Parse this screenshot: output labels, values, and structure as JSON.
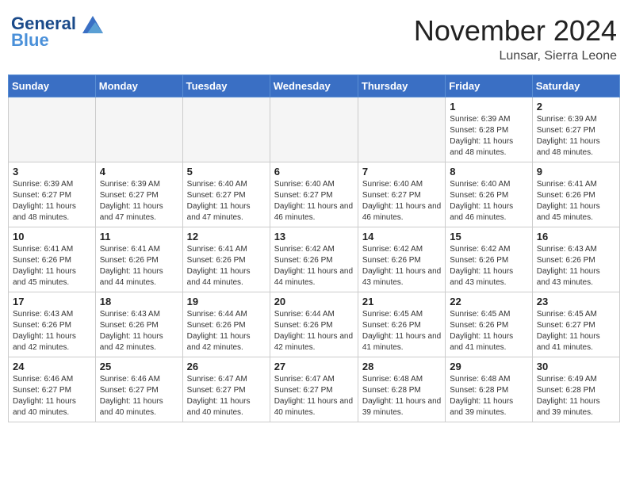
{
  "header": {
    "logo_line1": "General",
    "logo_line2": "Blue",
    "month_title": "November 2024",
    "location": "Lunsar, Sierra Leone"
  },
  "weekdays": [
    "Sunday",
    "Monday",
    "Tuesday",
    "Wednesday",
    "Thursday",
    "Friday",
    "Saturday"
  ],
  "weeks": [
    [
      {
        "day": "",
        "info": ""
      },
      {
        "day": "",
        "info": ""
      },
      {
        "day": "",
        "info": ""
      },
      {
        "day": "",
        "info": ""
      },
      {
        "day": "",
        "info": ""
      },
      {
        "day": "1",
        "info": "Sunrise: 6:39 AM\nSunset: 6:28 PM\nDaylight: 11 hours and 48 minutes."
      },
      {
        "day": "2",
        "info": "Sunrise: 6:39 AM\nSunset: 6:27 PM\nDaylight: 11 hours and 48 minutes."
      }
    ],
    [
      {
        "day": "3",
        "info": "Sunrise: 6:39 AM\nSunset: 6:27 PM\nDaylight: 11 hours and 48 minutes."
      },
      {
        "day": "4",
        "info": "Sunrise: 6:39 AM\nSunset: 6:27 PM\nDaylight: 11 hours and 47 minutes."
      },
      {
        "day": "5",
        "info": "Sunrise: 6:40 AM\nSunset: 6:27 PM\nDaylight: 11 hours and 47 minutes."
      },
      {
        "day": "6",
        "info": "Sunrise: 6:40 AM\nSunset: 6:27 PM\nDaylight: 11 hours and 46 minutes."
      },
      {
        "day": "7",
        "info": "Sunrise: 6:40 AM\nSunset: 6:27 PM\nDaylight: 11 hours and 46 minutes."
      },
      {
        "day": "8",
        "info": "Sunrise: 6:40 AM\nSunset: 6:26 PM\nDaylight: 11 hours and 46 minutes."
      },
      {
        "day": "9",
        "info": "Sunrise: 6:41 AM\nSunset: 6:26 PM\nDaylight: 11 hours and 45 minutes."
      }
    ],
    [
      {
        "day": "10",
        "info": "Sunrise: 6:41 AM\nSunset: 6:26 PM\nDaylight: 11 hours and 45 minutes."
      },
      {
        "day": "11",
        "info": "Sunrise: 6:41 AM\nSunset: 6:26 PM\nDaylight: 11 hours and 44 minutes."
      },
      {
        "day": "12",
        "info": "Sunrise: 6:41 AM\nSunset: 6:26 PM\nDaylight: 11 hours and 44 minutes."
      },
      {
        "day": "13",
        "info": "Sunrise: 6:42 AM\nSunset: 6:26 PM\nDaylight: 11 hours and 44 minutes."
      },
      {
        "day": "14",
        "info": "Sunrise: 6:42 AM\nSunset: 6:26 PM\nDaylight: 11 hours and 43 minutes."
      },
      {
        "day": "15",
        "info": "Sunrise: 6:42 AM\nSunset: 6:26 PM\nDaylight: 11 hours and 43 minutes."
      },
      {
        "day": "16",
        "info": "Sunrise: 6:43 AM\nSunset: 6:26 PM\nDaylight: 11 hours and 43 minutes."
      }
    ],
    [
      {
        "day": "17",
        "info": "Sunrise: 6:43 AM\nSunset: 6:26 PM\nDaylight: 11 hours and 42 minutes."
      },
      {
        "day": "18",
        "info": "Sunrise: 6:43 AM\nSunset: 6:26 PM\nDaylight: 11 hours and 42 minutes."
      },
      {
        "day": "19",
        "info": "Sunrise: 6:44 AM\nSunset: 6:26 PM\nDaylight: 11 hours and 42 minutes."
      },
      {
        "day": "20",
        "info": "Sunrise: 6:44 AM\nSunset: 6:26 PM\nDaylight: 11 hours and 42 minutes."
      },
      {
        "day": "21",
        "info": "Sunrise: 6:45 AM\nSunset: 6:26 PM\nDaylight: 11 hours and 41 minutes."
      },
      {
        "day": "22",
        "info": "Sunrise: 6:45 AM\nSunset: 6:26 PM\nDaylight: 11 hours and 41 minutes."
      },
      {
        "day": "23",
        "info": "Sunrise: 6:45 AM\nSunset: 6:27 PM\nDaylight: 11 hours and 41 minutes."
      }
    ],
    [
      {
        "day": "24",
        "info": "Sunrise: 6:46 AM\nSunset: 6:27 PM\nDaylight: 11 hours and 40 minutes."
      },
      {
        "day": "25",
        "info": "Sunrise: 6:46 AM\nSunset: 6:27 PM\nDaylight: 11 hours and 40 minutes."
      },
      {
        "day": "26",
        "info": "Sunrise: 6:47 AM\nSunset: 6:27 PM\nDaylight: 11 hours and 40 minutes."
      },
      {
        "day": "27",
        "info": "Sunrise: 6:47 AM\nSunset: 6:27 PM\nDaylight: 11 hours and 40 minutes."
      },
      {
        "day": "28",
        "info": "Sunrise: 6:48 AM\nSunset: 6:28 PM\nDaylight: 11 hours and 39 minutes."
      },
      {
        "day": "29",
        "info": "Sunrise: 6:48 AM\nSunset: 6:28 PM\nDaylight: 11 hours and 39 minutes."
      },
      {
        "day": "30",
        "info": "Sunrise: 6:49 AM\nSunset: 6:28 PM\nDaylight: 11 hours and 39 minutes."
      }
    ]
  ]
}
